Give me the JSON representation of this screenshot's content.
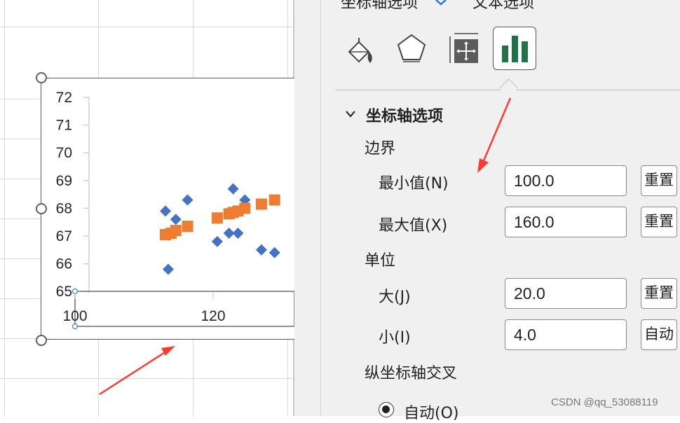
{
  "chart_data": {
    "type": "scatter",
    "x_ticks": [
      "100",
      "120"
    ],
    "y_ticks": [
      "72",
      "71",
      "70",
      "69",
      "68",
      "67",
      "66",
      "65"
    ],
    "xlim": [
      100,
      160
    ],
    "ylim": [
      65,
      72
    ],
    "series": [
      {
        "color": "#4472c4",
        "marker": "diamond",
        "points": [
          [
            113.1,
            67.9
          ],
          [
            113.5,
            65.8
          ],
          [
            114.6,
            67.6
          ],
          [
            116.3,
            68.3
          ],
          [
            120.6,
            66.8
          ],
          [
            122.3,
            67.1
          ],
          [
            122.9,
            68.7
          ],
          [
            123.6,
            67.1
          ],
          [
            124.6,
            68.3
          ],
          [
            127.0,
            66.5
          ],
          [
            128.9,
            66.4
          ]
        ]
      },
      {
        "color": "#ed7d31",
        "marker": "square",
        "points": [
          [
            113.1,
            67.05
          ],
          [
            113.9,
            67.1
          ],
          [
            114.6,
            67.2
          ],
          [
            116.3,
            67.35
          ],
          [
            120.6,
            67.65
          ],
          [
            122.3,
            67.8
          ],
          [
            122.9,
            67.85
          ],
          [
            123.6,
            67.9
          ],
          [
            124.6,
            68.0
          ],
          [
            127.0,
            68.15
          ],
          [
            128.9,
            68.3
          ]
        ]
      }
    ]
  },
  "panel": {
    "tabs": {
      "axis_options": "坐标轴选项",
      "text_options": "文本选项"
    },
    "icons": [
      "fill-line-icon",
      "effects-icon",
      "size-properties-icon",
      "axis-options-icon"
    ],
    "section_title": "坐标轴选项",
    "bounds": {
      "heading": "边界",
      "min_label": "最小值(N)",
      "min_value": "100.0",
      "max_label": "最大值(X)",
      "max_value": "160.0",
      "reset_label": "重置"
    },
    "units": {
      "heading": "单位",
      "major_label": "大(J)",
      "major_value": "20.0",
      "minor_label": "小(I)",
      "minor_value": "4.0",
      "reset_label": "重置",
      "auto_label": "自动"
    },
    "cross": {
      "heading": "纵坐标轴交叉",
      "auto_label": "自动(O)"
    }
  },
  "annotation_color": "#ff3b30",
  "watermark": "CSDN @qq_53088119"
}
